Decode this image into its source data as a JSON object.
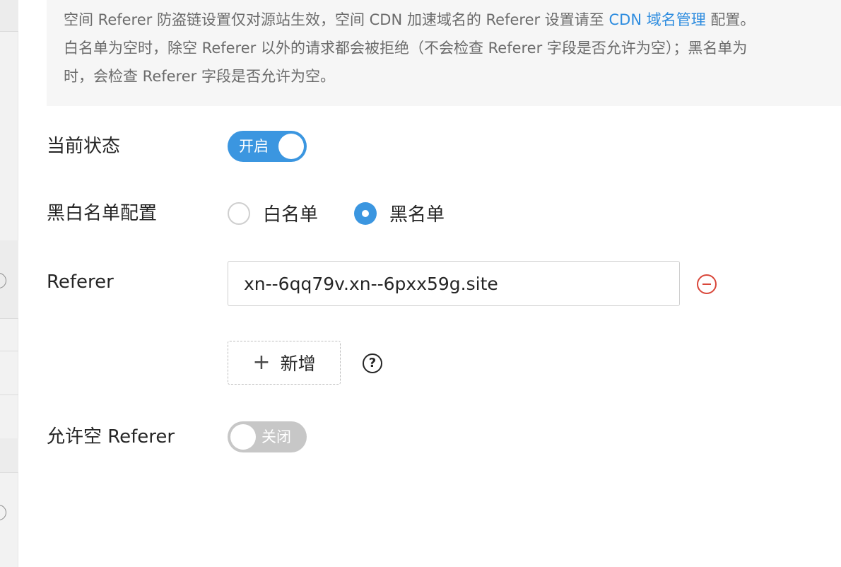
{
  "notice": {
    "line1_a": "空间 Referer 防盗链设置仅对源站生效，空间 CDN 加速域名的 Referer 设置请至 ",
    "line1_link": "CDN 域名管理",
    "line1_b": " 配置。",
    "line2": "白名单为空时，除空 Referer 以外的请求都会被拒绝（不会检查 Referer 字段是否允许为空）；黑名单为",
    "line3": "时，会检查 Referer 字段是否允许为空。"
  },
  "status": {
    "label": "当前状态",
    "toggle_text": "开启",
    "enabled": true
  },
  "list_mode": {
    "label": "黑白名单配置",
    "options": [
      "白名单",
      "黑名单"
    ],
    "selected": "黑名单"
  },
  "referer": {
    "label": "Referer",
    "value": "xn--6qq79v.xn--6pxx59g.site"
  },
  "add": {
    "label": "新增",
    "plus_glyph": "+"
  },
  "help_glyph": "?",
  "allow_empty": {
    "label": "允许空 Referer",
    "toggle_text": "关闭",
    "enabled": false
  },
  "colors": {
    "accent": "#3b96e0",
    "link": "#2d8cdf",
    "danger": "#d9473a",
    "toggle_off": "#c7c7c7"
  }
}
